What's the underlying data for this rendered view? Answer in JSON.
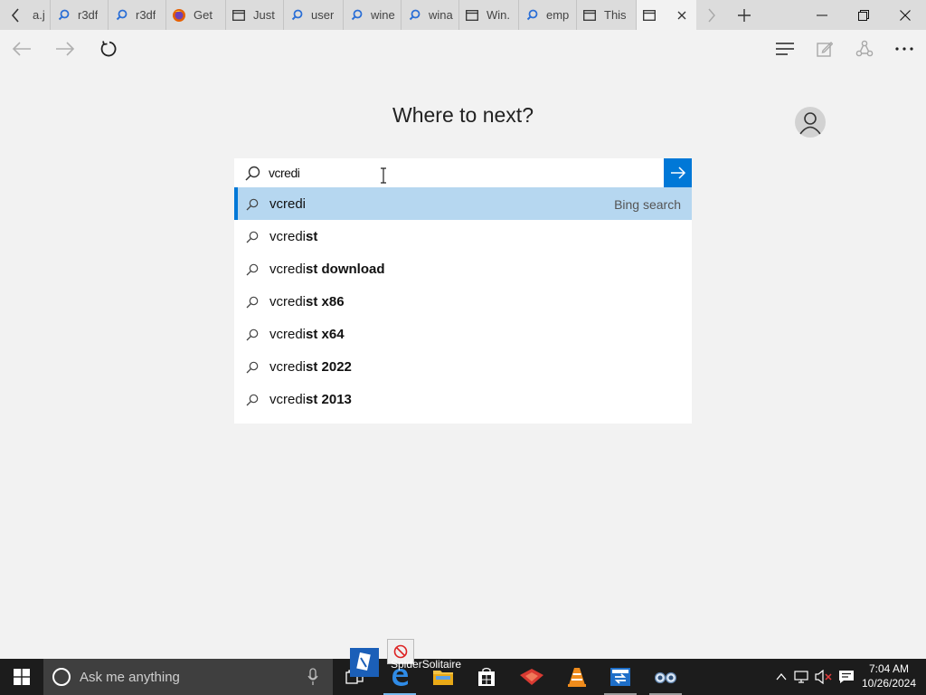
{
  "tabs": [
    {
      "label": "a.j",
      "icon": "search-icon"
    },
    {
      "label": "r3df",
      "icon": "search-icon"
    },
    {
      "label": "r3df",
      "icon": "search-icon"
    },
    {
      "label": "Get",
      "icon": "firefox-icon"
    },
    {
      "label": "Just",
      "icon": "page-icon"
    },
    {
      "label": "user",
      "icon": "search-icon"
    },
    {
      "label": "wine",
      "icon": "search-icon"
    },
    {
      "label": "wina",
      "icon": "search-icon"
    },
    {
      "label": "Win.",
      "icon": "page-icon"
    },
    {
      "label": "emp",
      "icon": "search-icon"
    },
    {
      "label": "This",
      "icon": "page-icon"
    },
    {
      "label": "",
      "icon": "page-icon",
      "active": true
    }
  ],
  "main": {
    "heading": "Where to next?",
    "search_value": "vcredi"
  },
  "suggestions": [
    {
      "typed": "vcredi",
      "rest": "",
      "engine": "Bing search",
      "selected": true
    },
    {
      "typed": "vcredi",
      "rest": "st"
    },
    {
      "typed": "vcredi",
      "rest": "st download"
    },
    {
      "typed": "vcredi",
      "rest": "st x86"
    },
    {
      "typed": "vcredi",
      "rest": "st x64"
    },
    {
      "typed": "vcredi",
      "rest": "st 2022"
    },
    {
      "typed": "vcredi",
      "rest": "st 2013"
    }
  ],
  "taskbar": {
    "search_placeholder": "Ask me anything",
    "drag_label": "SpiderSolitaire",
    "time": "7:04 AM",
    "date": "10/26/2024"
  },
  "colors": {
    "accent": "#0078d7",
    "selection": "#b6d7f0",
    "taskbar": "#1c1c1c"
  }
}
